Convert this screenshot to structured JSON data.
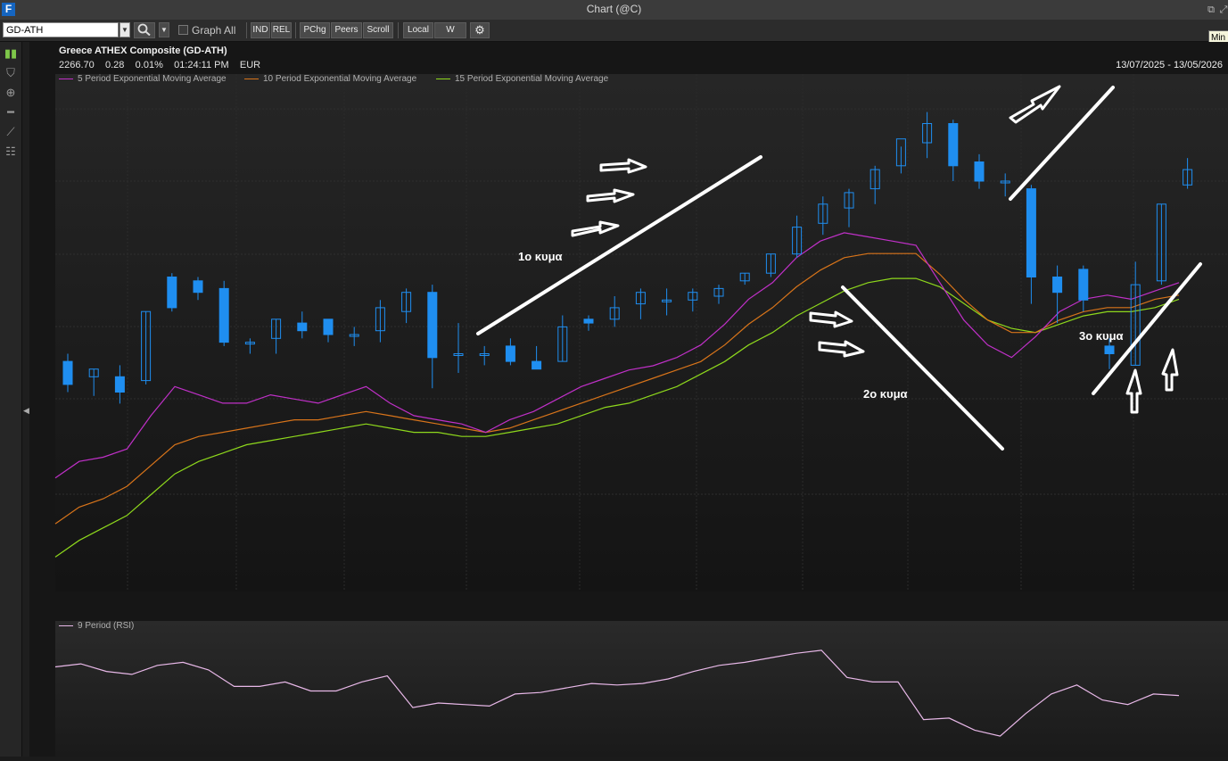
{
  "window": {
    "title": "Chart (@C)"
  },
  "toolbar": {
    "symbol_value": "GD-ATH",
    "graph_all_label": "Graph All",
    "buttons": [
      "IND",
      "REL",
      "PChg",
      "Peers",
      "Scroll",
      "Local",
      "W"
    ],
    "tooltip_text": "Min"
  },
  "chart_header": {
    "name": "Greece ATHEX Composite (GD-ATH)",
    "last": "2266.70",
    "change": "0.28",
    "change_pct": "0.01%",
    "time": "01:24:11 PM",
    "currency": "EUR",
    "date_range": "13/07/2025 - 13/05/2026"
  },
  "legend": [
    {
      "label": "5 Period Exponential Moving Average",
      "color": "#c030c8"
    },
    {
      "label": "10 Period Exponential Moving Average",
      "color": "#d8741a"
    },
    {
      "label": "15 Period Exponential Moving Average",
      "color": "#8ed81c"
    }
  ],
  "rsi_panel": {
    "label": "9 Period (RSI)"
  },
  "annotations": {
    "wave1": "1ο κυμα",
    "wave2": "2ο κυμα",
    "wave3": "3ο κυμα"
  },
  "colors": {
    "candle": "#1f8ef0",
    "rsi_line": "#e8b8e8",
    "annotation": "#ffffff",
    "background": "#161616"
  },
  "chart_data": {
    "type": "candlestick",
    "period": "weekly",
    "candles_count": 44,
    "series_order_note": "oldest to newest, relative price index 0-100 (no price axis printed)",
    "ohlc": [
      {
        "o": 33,
        "h": 35,
        "l": 25,
        "c": 27
      },
      {
        "o": 29,
        "h": 31,
        "l": 24,
        "c": 31
      },
      {
        "o": 29,
        "h": 32,
        "l": 22,
        "c": 25
      },
      {
        "o": 28,
        "h": 46,
        "l": 27,
        "c": 46
      },
      {
        "o": 55,
        "h": 56,
        "l": 46,
        "c": 47
      },
      {
        "o": 54,
        "h": 55,
        "l": 49,
        "c": 51
      },
      {
        "o": 52,
        "h": 54,
        "l": 37,
        "c": 38
      },
      {
        "o": 38,
        "h": 39,
        "l": 35,
        "c": 38
      },
      {
        "o": 39,
        "h": 44,
        "l": 35,
        "c": 44
      },
      {
        "o": 43,
        "h": 46,
        "l": 39,
        "c": 41
      },
      {
        "o": 44,
        "h": 44,
        "l": 38,
        "c": 40
      },
      {
        "o": 40,
        "h": 42,
        "l": 37,
        "c": 40
      },
      {
        "o": 41,
        "h": 49,
        "l": 38,
        "c": 47
      },
      {
        "o": 46,
        "h": 52,
        "l": 43,
        "c": 51
      },
      {
        "o": 51,
        "h": 53,
        "l": 26,
        "c": 34
      },
      {
        "o": 35,
        "h": 43,
        "l": 30,
        "c": 35
      },
      {
        "o": 35,
        "h": 37,
        "l": 32,
        "c": 35
      },
      {
        "o": 37,
        "h": 39,
        "l": 32,
        "c": 33
      },
      {
        "o": 33,
        "h": 37,
        "l": 31,
        "c": 31
      },
      {
        "o": 33,
        "h": 45,
        "l": 33,
        "c": 42
      },
      {
        "o": 44,
        "h": 45,
        "l": 41,
        "c": 43
      },
      {
        "o": 44,
        "h": 50,
        "l": 42,
        "c": 47
      },
      {
        "o": 48,
        "h": 52,
        "l": 44,
        "c": 51
      },
      {
        "o": 49,
        "h": 52,
        "l": 45,
        "c": 49
      },
      {
        "o": 49,
        "h": 52,
        "l": 46,
        "c": 51
      },
      {
        "o": 50,
        "h": 53,
        "l": 48,
        "c": 52
      },
      {
        "o": 54,
        "h": 56,
        "l": 53,
        "c": 56
      },
      {
        "o": 56,
        "h": 61,
        "l": 55,
        "c": 61
      },
      {
        "o": 61,
        "h": 71,
        "l": 60,
        "c": 68
      },
      {
        "o": 69,
        "h": 76,
        "l": 66,
        "c": 74
      },
      {
        "o": 73,
        "h": 78,
        "l": 68,
        "c": 77
      },
      {
        "o": 78,
        "h": 84,
        "l": 74,
        "c": 83
      },
      {
        "o": 84,
        "h": 89,
        "l": 82,
        "c": 91
      },
      {
        "o": 90,
        "h": 98,
        "l": 86,
        "c": 95
      },
      {
        "o": 95,
        "h": 96,
        "l": 80,
        "c": 84
      },
      {
        "o": 85,
        "h": 87,
        "l": 78,
        "c": 80
      },
      {
        "o": 80,
        "h": 82,
        "l": 76,
        "c": 80
      },
      {
        "o": 78,
        "h": 79,
        "l": 48,
        "c": 55
      },
      {
        "o": 55,
        "h": 58,
        "l": 43,
        "c": 51
      },
      {
        "o": 57,
        "h": 58,
        "l": 46,
        "c": 49
      },
      {
        "o": 37,
        "h": 39,
        "l": 31,
        "c": 35
      },
      {
        "o": 32,
        "h": 59,
        "l": 32,
        "c": 53
      },
      {
        "o": 54,
        "h": 74,
        "l": 53,
        "c": 74
      },
      {
        "o": 79,
        "h": 86,
        "l": 78,
        "c": 83
      }
    ],
    "ema5": [
      23,
      27,
      28,
      30,
      38,
      45,
      43,
      41,
      41,
      43,
      42,
      41,
      43,
      45,
      41,
      38,
      37,
      36,
      34,
      37,
      39,
      42,
      45,
      47,
      49,
      50,
      52,
      55,
      60,
      66,
      70,
      76,
      80,
      82,
      81,
      80,
      79,
      70,
      61,
      55,
      52,
      57,
      63,
      66,
      67,
      66,
      68,
      70
    ],
    "ema10": [
      12,
      16,
      18,
      21,
      26,
      31,
      33,
      34,
      35,
      36,
      37,
      37,
      38,
      39,
      38,
      37,
      36,
      35,
      34,
      35,
      37,
      39,
      41,
      43,
      45,
      47,
      49,
      51,
      55,
      60,
      64,
      69,
      73,
      76,
      77,
      77,
      77,
      72,
      66,
      61,
      58,
      58,
      61,
      63,
      64,
      64,
      66,
      67
    ],
    "ema15": [
      4,
      8,
      11,
      14,
      19,
      24,
      27,
      29,
      31,
      32,
      33,
      34,
      35,
      36,
      35,
      34,
      34,
      33,
      33,
      34,
      35,
      36,
      38,
      40,
      41,
      43,
      45,
      48,
      51,
      55,
      58,
      62,
      65,
      68,
      70,
      71,
      71,
      69,
      65,
      61,
      59,
      58,
      60,
      62,
      63,
      63,
      64,
      66
    ],
    "rsi": [
      66,
      68,
      63,
      61,
      67,
      69,
      64,
      53,
      53,
      56,
      50,
      50,
      56,
      60,
      39,
      42,
      41,
      40,
      48,
      49,
      52,
      55,
      54,
      55,
      58,
      63,
      67,
      69,
      72,
      75,
      77,
      59,
      56,
      56,
      31,
      32,
      24,
      20,
      35,
      48,
      54,
      44,
      41,
      48,
      47
    ]
  }
}
